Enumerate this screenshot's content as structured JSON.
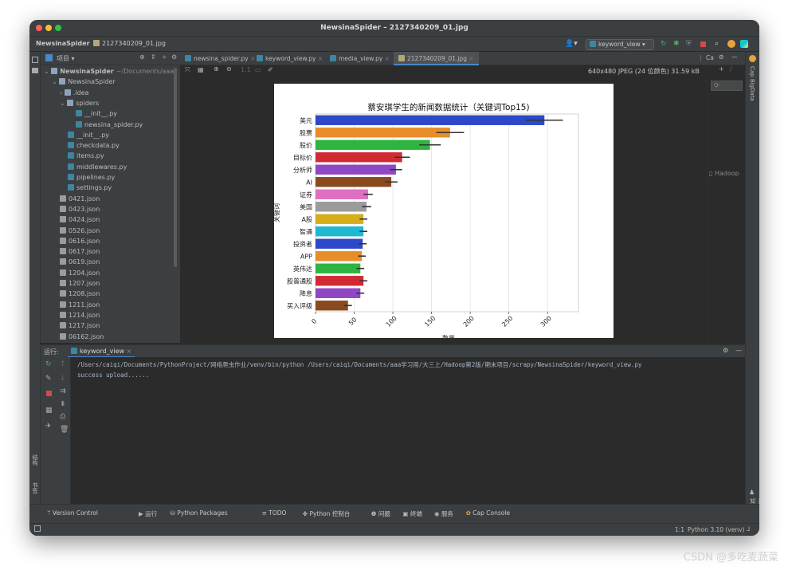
{
  "window": {
    "title": "NewsinaSpider – 2127340209_01.jpg"
  },
  "navbar": {
    "project": "NewsinaSpider",
    "file": "2127340209_01.jpg",
    "run_config": "keyword_view"
  },
  "project_panel": {
    "header_label": "项目",
    "items": [
      {
        "label": "NewsinaSpider",
        "suffix": "~/Documents/aaa",
        "indent": 0,
        "icon": "folder-icon",
        "bold": true,
        "arrow": "chevron-down-icon"
      },
      {
        "label": "NewsinaSpider",
        "indent": 1,
        "icon": "package-folder-icon",
        "arrow": "chevron-down-icon"
      },
      {
        "label": ".idea",
        "indent": 2,
        "icon": "folder-icon",
        "arrow": "chevron-right-icon"
      },
      {
        "label": "spiders",
        "indent": 2,
        "icon": "package-folder-icon",
        "arrow": "chevron-down-icon"
      },
      {
        "label": "__init__.py",
        "indent": 4,
        "icon": "python-file-icon"
      },
      {
        "label": "newsina_spider.py",
        "indent": 4,
        "icon": "python-file-icon"
      },
      {
        "label": "__init__.py",
        "indent": 3,
        "icon": "python-file-icon"
      },
      {
        "label": "checkdata.py",
        "indent": 3,
        "icon": "python-file-icon"
      },
      {
        "label": "items.py",
        "indent": 3,
        "icon": "python-file-icon"
      },
      {
        "label": "middlewares.py",
        "indent": 3,
        "icon": "python-file-icon"
      },
      {
        "label": "pipelines.py",
        "indent": 3,
        "icon": "python-file-icon"
      },
      {
        "label": "settings.py",
        "indent": 3,
        "icon": "python-file-icon"
      },
      {
        "label": "0421.json",
        "indent": 2,
        "icon": "json-file-icon"
      },
      {
        "label": "0423.json",
        "indent": 2,
        "icon": "json-file-icon"
      },
      {
        "label": "0424.json",
        "indent": 2,
        "icon": "json-file-icon"
      },
      {
        "label": "0526.json",
        "indent": 2,
        "icon": "json-file-icon"
      },
      {
        "label": "0616.json",
        "indent": 2,
        "icon": "json-file-icon"
      },
      {
        "label": "0617.json",
        "indent": 2,
        "icon": "json-file-icon"
      },
      {
        "label": "0619.json",
        "indent": 2,
        "icon": "json-file-icon"
      },
      {
        "label": "1204.json",
        "indent": 2,
        "icon": "json-file-icon"
      },
      {
        "label": "1207.json",
        "indent": 2,
        "icon": "json-file-icon"
      },
      {
        "label": "1208.json",
        "indent": 2,
        "icon": "json-file-icon"
      },
      {
        "label": "1211.json",
        "indent": 2,
        "icon": "json-file-icon"
      },
      {
        "label": "1214.json",
        "indent": 2,
        "icon": "json-file-icon"
      },
      {
        "label": "1217.json",
        "indent": 2,
        "icon": "json-file-icon"
      },
      {
        "label": "06162.json",
        "indent": 2,
        "icon": "json-file-icon"
      }
    ]
  },
  "editor": {
    "tabs": [
      {
        "label": "newsina_spider.py",
        "icon": "python-file-icon",
        "active": false
      },
      {
        "label": "keyword_view.py",
        "icon": "python-file-icon",
        "active": false
      },
      {
        "label": "media_view.py",
        "icon": "python-file-icon",
        "active": false
      },
      {
        "label": "2127340209_01.jpg",
        "icon": "image-file-icon",
        "active": true
      }
    ],
    "image_info": "640x480 JPEG (24 位颜色) 31.59 kB"
  },
  "right_panel": {
    "search_placeholder": "Q-",
    "hadoop_label": "Hadoop",
    "strip_label": "Cap BigData"
  },
  "right_toolbar_label": "Ca",
  "run": {
    "header_label": "运行:",
    "tab_label": "keyword_view",
    "console_lines": [
      "/Users/caiqi/Documents/PythonProject/网络爬虫作业/venv/bin/python /Users/caiqi/Documents/aaa学习用/大三上/Hadoop第2版/期末项目/scrapy/NewsinaSpider/keyword_view.py",
      "success upload......"
    ]
  },
  "left_strip_labels": {
    "structure": "结构",
    "bookmarks": "书签"
  },
  "bottom_tabs": [
    {
      "label": "Version Control",
      "icon": "branch-icon"
    },
    {
      "label": "运行",
      "icon": "play-icon"
    },
    {
      "label": "Python Packages",
      "icon": "packages-icon"
    },
    {
      "label": "TODO",
      "icon": "list-icon"
    },
    {
      "label": "Python 控制台",
      "icon": "python-console-icon"
    },
    {
      "label": "问题",
      "icon": "info-icon"
    },
    {
      "label": "终端",
      "icon": "terminal-icon"
    },
    {
      "label": "服务",
      "icon": "services-icon"
    },
    {
      "label": "Cap Console",
      "icon": "cap-icon"
    }
  ],
  "status": {
    "position": "1:1",
    "interpreter": "Python 3.10 (venv)"
  },
  "notification_label": "通知",
  "watermark": "CSDN @多吃麦蔬菜",
  "chart_data": {
    "type": "bar",
    "orientation": "horizontal",
    "title": "蔡安琪学生的新闻数据统计（关键词Top15)",
    "xlabel": "数量",
    "ylabel": "关键词",
    "xlim": [
      0,
      340
    ],
    "xticks": [
      0,
      50,
      100,
      150,
      200,
      250,
      300
    ],
    "grid": true,
    "categories": [
      "美元",
      "股票",
      "股价",
      "目标价",
      "分析师",
      "AI",
      "证券",
      "美国",
      "A股",
      "智通",
      "投资者",
      "APP",
      "英伟达",
      "股普通股",
      "降息",
      "买入评级"
    ],
    "values": [
      296,
      174,
      148,
      112,
      104,
      98,
      68,
      66,
      62,
      62,
      61,
      60,
      58,
      62,
      58,
      42
    ],
    "errors": [
      24,
      18,
      14,
      10,
      8,
      8,
      6,
      6,
      5,
      5,
      5,
      5,
      5,
      5,
      5,
      5
    ],
    "colors": [
      "#2d48c9",
      "#e88d29",
      "#2fb53f",
      "#d22a34",
      "#8f47c4",
      "#8a4a1f",
      "#e06fc2",
      "#9b9b9b",
      "#d6ad1b",
      "#1fb8d1",
      "#2d48c9",
      "#e88d29",
      "#2fb53f",
      "#d22a34",
      "#8f47c4",
      "#8a4a1f"
    ]
  }
}
